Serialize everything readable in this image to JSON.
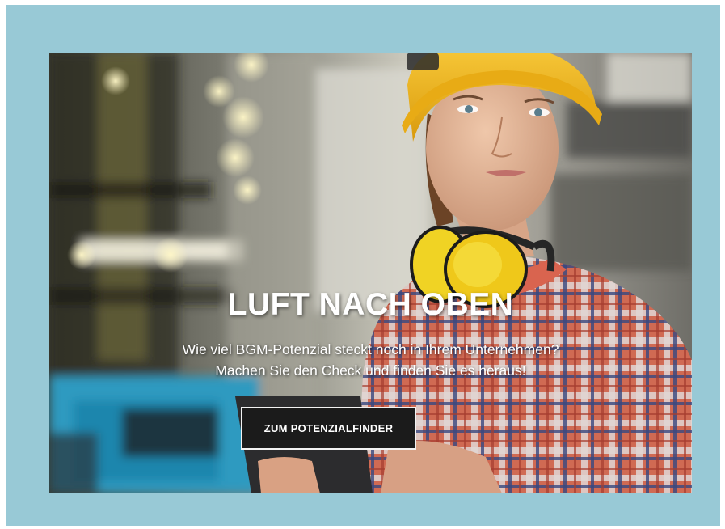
{
  "hero": {
    "headline": "LUFT NACH OBEN",
    "subline_1": "Wie viel BGM-Potenzial steckt noch in Ihrem Unternehmen?",
    "subline_2": "Machen Sie den Check und finden Sie es heraus!",
    "cta_label": "ZUM POTENZIALFINDER",
    "image": "photo of a female worker wearing a yellow hard hat, yellow ear defenders and a plaid shirt, holding a tablet in a factory hall"
  },
  "colors": {
    "frame_background": "#98c9d6",
    "headline_text": "#ffffff",
    "cta_background": "#1b1b1b",
    "cta_border": "#f2f2f2",
    "helmet_yellow": "#f3b61c"
  }
}
